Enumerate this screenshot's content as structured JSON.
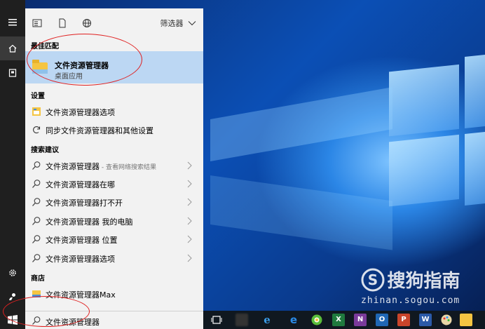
{
  "toolbar": {
    "filter_label": "筛选器"
  },
  "sections": {
    "best_match": "最佳匹配",
    "settings": "设置",
    "suggestions": "搜索建议",
    "store": "商店"
  },
  "best_match": {
    "title": "文件资源管理器",
    "subtitle": "桌面应用"
  },
  "settings_items": [
    {
      "label": "文件资源管理器选项",
      "icon": "settings-window-icon"
    },
    {
      "label": "同步文件资源管理器和其他设置",
      "icon": "sync-icon"
    }
  ],
  "suggestion_items": [
    {
      "label": "文件资源管理器",
      "sub": " - 查看网络搜索结果"
    },
    {
      "label": "文件资源管理器在哪",
      "sub": ""
    },
    {
      "label": "文件资源管理器打不开",
      "sub": ""
    },
    {
      "label": "文件资源管理器 我的电脑",
      "sub": ""
    },
    {
      "label": "文件资源管理器 位置",
      "sub": ""
    },
    {
      "label": "文件资源管理器选项",
      "sub": ""
    }
  ],
  "store_items": [
    {
      "label": "文件资源管理器Max"
    }
  ],
  "search": {
    "value": "文件资源管理器"
  },
  "taskbar_icons": [
    "task-view-icon",
    "blurred-app-icon",
    "ie-icon",
    "edge-icon",
    "360-browser-icon",
    "excel-icon",
    "onenote-icon",
    "outlook-icon",
    "powerpoint-icon",
    "word-icon",
    "paint-icon",
    "file-explorer-icon"
  ],
  "watermark": {
    "brand": "搜狗指南",
    "url": "zhinan.sogou.com"
  },
  "colors": {
    "selected": "#bcd7f3",
    "annotation": "#e02020",
    "rail": "#1f1f1f"
  }
}
